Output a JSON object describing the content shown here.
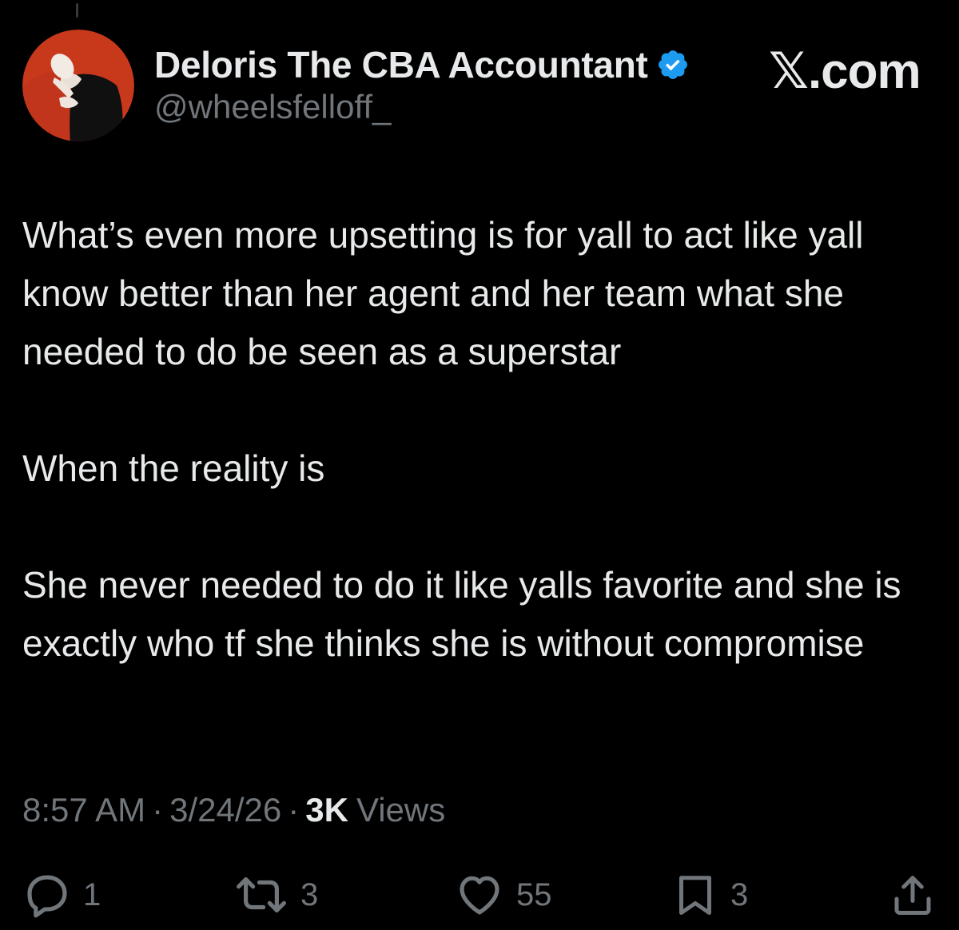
{
  "author": {
    "name": "Deloris The CBA Accountant",
    "handle": "@wheelsfelloff_",
    "verified": true,
    "verified_color": "#1d9bf0",
    "avatar_background": "#c8391c"
  },
  "watermark": "𝕏.com",
  "tweet": {
    "paragraphs": [
      "What’s even more upsetting is for yall to act like yall know better than her agent and her team what she needed to do be seen as a superstar",
      "When the reality is",
      "She never needed to do it like yalls favorite and she is exactly who tf she thinks she is without compromise"
    ]
  },
  "meta": {
    "time": "8:57 AM",
    "separator": "·",
    "date": "3/24/26",
    "views_count": "3K",
    "views_label": "Views"
  },
  "actions": {
    "replies": "1",
    "reposts": "3",
    "likes": "55",
    "bookmarks": "3"
  },
  "icons": {
    "reply": "reply-icon",
    "repost": "repost-icon",
    "like": "heart-icon",
    "bookmark": "bookmark-icon",
    "share": "share-icon",
    "verified": "verified-badge-icon"
  },
  "colors": {
    "background": "#000000",
    "text": "#e7e9ea",
    "secondary": "#71767b"
  }
}
